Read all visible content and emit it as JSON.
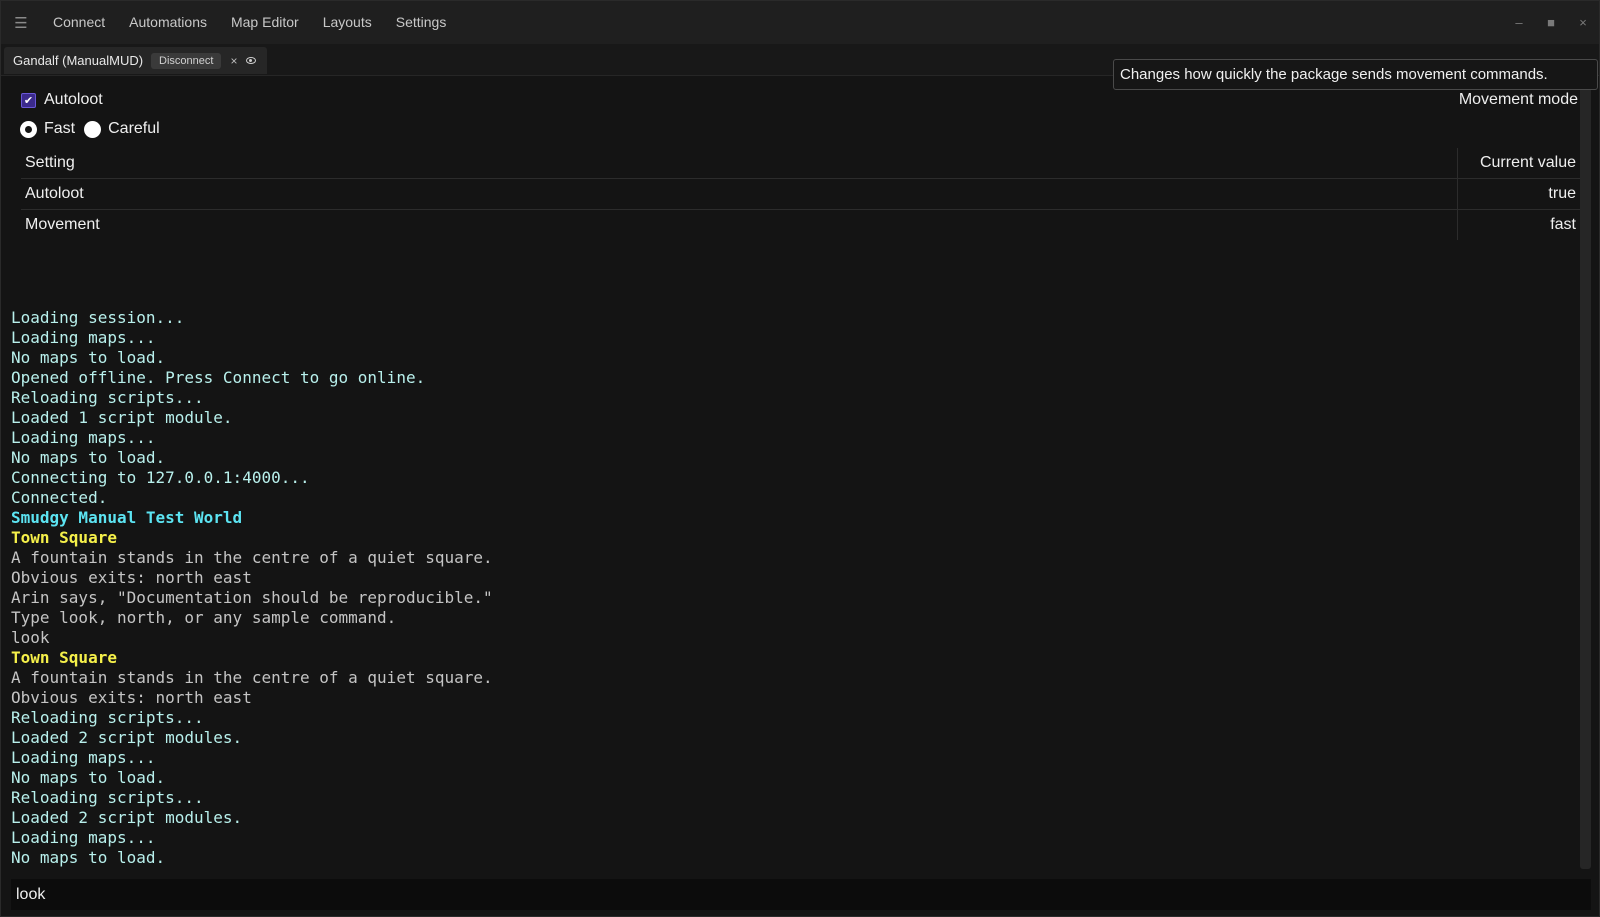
{
  "menu": {
    "hamburger_icon": "hamburger-icon",
    "items": [
      "Connect",
      "Automations",
      "Map Editor",
      "Layouts",
      "Settings"
    ]
  },
  "window_controls": {
    "minimize": "–",
    "maximize": "■",
    "close": "×"
  },
  "tab": {
    "title": "Gandalf (ManualMUD)",
    "disconnect_label": "Disconnect",
    "close_label": "×",
    "eye_icon": "eye-icon"
  },
  "tooltip": {
    "text": "Changes how quickly the package sends movement commands."
  },
  "settings": {
    "autoloot_label": "Autoloot",
    "autoloot_checked": true,
    "movement_mode_label": "Movement mode",
    "radios": [
      {
        "label": "Fast",
        "selected": true
      },
      {
        "label": "Careful",
        "selected": false
      }
    ],
    "table": {
      "headers": [
        "Setting",
        "Current value"
      ],
      "rows": [
        {
          "setting": "Autoloot",
          "value": "true"
        },
        {
          "setting": "Movement",
          "value": "fast"
        }
      ]
    }
  },
  "terminal": {
    "colors": {
      "system": "#b8f0ec",
      "title": "#5ce4f2",
      "room": "#f5f04a",
      "text": "#c4c4c4",
      "echo": "#c4c4c4"
    },
    "lines": [
      {
        "text": "Loading session...",
        "style": "system"
      },
      {
        "text": "Loading maps...",
        "style": "system"
      },
      {
        "text": "No maps to load.",
        "style": "system"
      },
      {
        "text": "Opened offline. Press Connect to go online.",
        "style": "system"
      },
      {
        "text": "Reloading scripts...",
        "style": "system"
      },
      {
        "text": "Loaded 1 script module.",
        "style": "system"
      },
      {
        "text": "Loading maps...",
        "style": "system"
      },
      {
        "text": "No maps to load.",
        "style": "system"
      },
      {
        "text": "Connecting to 127.0.0.1:4000...",
        "style": "system"
      },
      {
        "text": "Connected.",
        "style": "system"
      },
      {
        "text": "Smudgy Manual Test World",
        "style": "title",
        "bold": true
      },
      {
        "text": "Town Square",
        "style": "room",
        "bold": true
      },
      {
        "text": "A fountain stands in the centre of a quiet square.",
        "style": "text"
      },
      {
        "text": "Obvious exits: north east",
        "style": "text"
      },
      {
        "text": "Arin says, \"Documentation should be reproducible.\"",
        "style": "text"
      },
      {
        "text": "Type look, north, or any sample command.",
        "style": "text"
      },
      {
        "text": "look",
        "style": "echo"
      },
      {
        "text": "Town Square",
        "style": "room",
        "bold": true
      },
      {
        "text": "A fountain stands in the centre of a quiet square.",
        "style": "text"
      },
      {
        "text": "Obvious exits: north east",
        "style": "text"
      },
      {
        "text": "Reloading scripts...",
        "style": "system"
      },
      {
        "text": "Loaded 2 script modules.",
        "style": "system"
      },
      {
        "text": "Loading maps...",
        "style": "system"
      },
      {
        "text": "No maps to load.",
        "style": "system"
      },
      {
        "text": "Reloading scripts...",
        "style": "system"
      },
      {
        "text": "Loaded 2 script modules.",
        "style": "system"
      },
      {
        "text": "Loading maps...",
        "style": "system"
      },
      {
        "text": "No maps to load.",
        "style": "system"
      }
    ]
  },
  "input": {
    "value": "look"
  }
}
